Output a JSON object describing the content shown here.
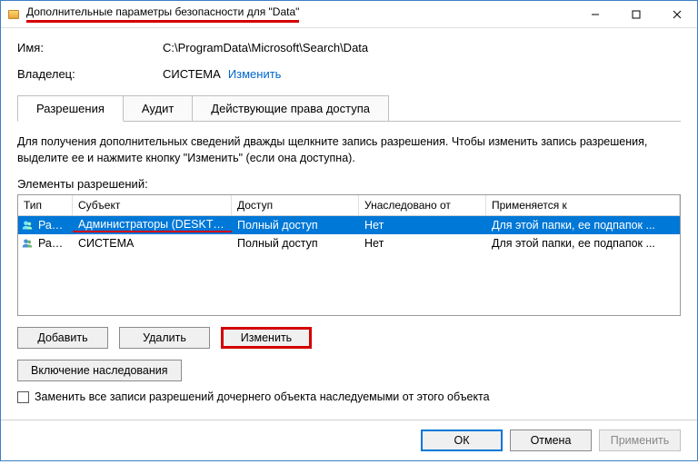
{
  "window": {
    "title": "Дополнительные параметры безопасности  для \"Data\""
  },
  "meta": {
    "name_label": "Имя:",
    "name_value": "C:\\ProgramData\\Microsoft\\Search\\Data",
    "owner_label": "Владелец:",
    "owner_value": "СИСТЕМА",
    "owner_change_link": "Изменить"
  },
  "tabs": [
    "Разрешения",
    "Аудит",
    "Действующие права доступа"
  ],
  "description": "Для получения дополнительных сведений дважды щелкните запись разрешения. Чтобы изменить запись разрешения, выделите ее и нажмите кнопку \"Изменить\" (если она доступна).",
  "list_label": "Элементы разрешений:",
  "columns": [
    "Тип",
    "Субъект",
    "Доступ",
    "Унаследовано от",
    "Применяется к"
  ],
  "rows": [
    {
      "type": "Разр...",
      "subject": "Администраторы (DESKTOP-...",
      "access": "Полный доступ",
      "inherited": "Нет",
      "applies": "Для этой папки, ее подпапок ..."
    },
    {
      "type": "Разр...",
      "subject": "СИСТЕМА",
      "access": "Полный доступ",
      "inherited": "Нет",
      "applies": "Для этой папки, ее подпапок ..."
    }
  ],
  "buttons": {
    "add": "Добавить",
    "remove": "Удалить",
    "edit": "Изменить",
    "enable_inherit": "Включение наследования"
  },
  "replace_checkbox": "Заменить все записи разрешений дочернего объекта наследуемыми от этого объекта",
  "footer": {
    "ok": "ОК",
    "cancel": "Отмена",
    "apply": "Применить"
  }
}
